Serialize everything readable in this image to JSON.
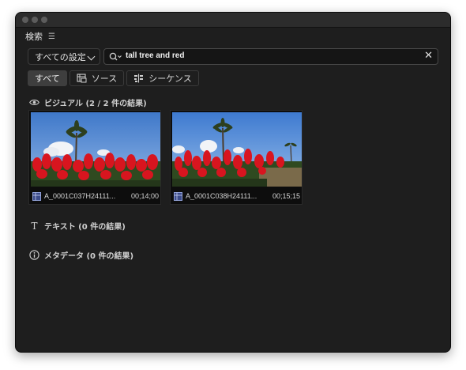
{
  "panel": {
    "title": "検索"
  },
  "filter": {
    "selected": "すべての設定"
  },
  "search": {
    "query": "tall tree and red",
    "clear_symbol": "✕"
  },
  "tabs": [
    {
      "label": "すべて",
      "active": true
    },
    {
      "label": "ソース",
      "active": false
    },
    {
      "label": "シーケンス",
      "active": false
    }
  ],
  "sections": {
    "visual": {
      "label": "ビジュアル (2 / 2 件の結果)"
    },
    "text": {
      "label": "テキスト (0 件の結果)"
    },
    "metadata": {
      "label": "メタデータ (0 件の結果)"
    }
  },
  "results": [
    {
      "name": "A_0001C037H24111...",
      "duration": "00;14;00"
    },
    {
      "name": "A_0001C038H24111...",
      "duration": "00;15;15"
    }
  ],
  "colors": {
    "sky": "#5b8fd6",
    "flowers": "#d4151f",
    "foliage": "#3f5a2a",
    "panel_bg": "#1e1e1e"
  }
}
